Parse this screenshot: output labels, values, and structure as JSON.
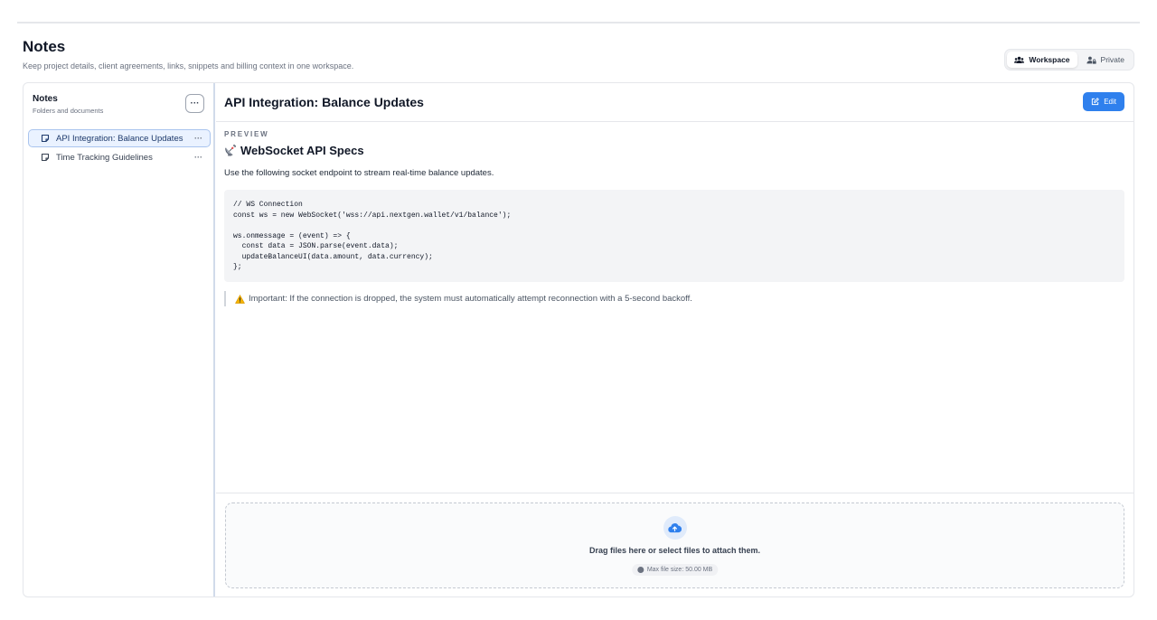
{
  "page": {
    "title": "Notes",
    "subtitle": "Keep project details, client agreements, links, snippets and billing context in one workspace."
  },
  "scope_toggle": {
    "options": [
      {
        "label": "Workspace",
        "icon": "users-icon",
        "active": true
      },
      {
        "label": "Private",
        "icon": "user-lock-icon",
        "active": false
      }
    ]
  },
  "sidebar": {
    "title": "Notes",
    "subtitle": "Folders and documents",
    "more_label": "···",
    "items": [
      {
        "label": "API Integration: Balance Updates",
        "icon": "note-icon",
        "more": "···",
        "active": true
      },
      {
        "label": "Time Tracking Guidelines",
        "icon": "note-icon",
        "more": "···",
        "active": false
      }
    ]
  },
  "note": {
    "title": "API Integration: Balance Updates",
    "edit_label": "Edit",
    "preview_label": "PREVIEW",
    "heading": "WebSocket API Specs",
    "heading_icon": "satellite-antenna-icon",
    "paragraph": "Use the following socket endpoint to stream real-time balance updates.",
    "code": "// WS Connection\nconst ws = new WebSocket('wss://api.nextgen.wallet/v1/balance');\n\nws.onmessage = (event) => {\n  const data = JSON.parse(event.data);\n  updateBalanceUI(data.amount, data.currency);\n};",
    "callout": "Important: If the connection is dropped, the system must automatically attempt reconnection with a 5-second backoff.",
    "callout_icon": "warning-icon"
  },
  "dropzone": {
    "text": "Drag files here or select files to attach them.",
    "limit": "Max file size: 50.00 MB",
    "icon": "cloud-upload-icon"
  },
  "colors": {
    "accent": "#2f80ed",
    "active_item_bg": "#eaf2ff",
    "active_item_border": "#a9c4ee"
  }
}
